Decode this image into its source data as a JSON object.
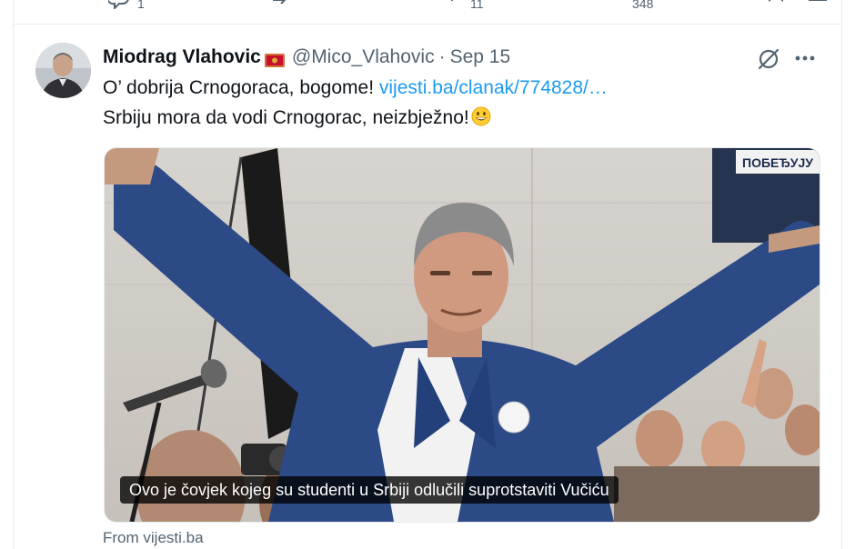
{
  "prev_actions": {
    "reply_count": "1",
    "like_count": "11",
    "view_count": "348"
  },
  "tweet": {
    "author_name": "Miodrag Vlahovic",
    "flag_icon": "montenegro-flag-icon",
    "handle": "@Mico_Vlahovic",
    "separator": "·",
    "date": "Sep 15",
    "text_line1_prefix": "O’ dobrija Crnogoraca, bogome! ",
    "text_line1_link": "vijesti.ba/clanak/774828/…",
    "text_line2": "Srbiju mora da vodi Crnogorac, neizbježno!",
    "emoji_icon": "grinning-face-emoji",
    "media": {
      "banner_text": "ПОБЕЂУЈУ",
      "caption": "Ovo je čovjek kojeg su studenti u Srbiji odlučili suprotstaviti Vučiću"
    },
    "card_source": "From vijesti.ba"
  },
  "colors": {
    "link": "#1d9bf0",
    "secondary_text": "#536471",
    "suit_blue": "#2c4a86"
  }
}
